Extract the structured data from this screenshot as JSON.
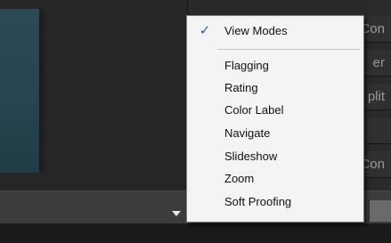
{
  "panel": {
    "rows": [
      "Con",
      "er",
      "plit",
      "",
      "Con"
    ]
  },
  "menu": {
    "checked_label": "View Modes",
    "check_glyph": "✓",
    "items": [
      "Flagging",
      "Rating",
      "Color Label",
      "Navigate",
      "Slideshow",
      "Zoom",
      "Soft Proofing"
    ]
  },
  "icons": {
    "dropdown": "chevron-down-icon",
    "check": "checkmark-icon"
  },
  "colors": {
    "check_accent": "#1f5fbf",
    "menu_background": "#f4f4f4"
  }
}
